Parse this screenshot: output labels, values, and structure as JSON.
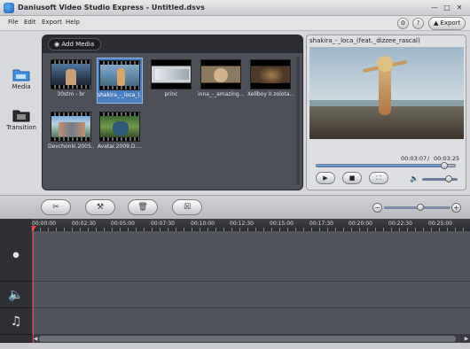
{
  "window": {
    "title": "Daniusoft Video Studio Express - Untitled.dsvs"
  },
  "menu": {
    "items": [
      "File",
      "Edit",
      "Export",
      "Help"
    ],
    "export_label": "Export"
  },
  "sidebar": {
    "items": [
      {
        "label": "Media",
        "icon": "media-folder-icon"
      },
      {
        "label": "Transition",
        "icon": "transition-icon"
      }
    ]
  },
  "media": {
    "add_label": "Add Media",
    "thumbnails": [
      {
        "caption": "30stm - br",
        "selected": false
      },
      {
        "caption": "shakira_-_loca_(...",
        "selected": true
      },
      {
        "caption": "princ",
        "selected": false
      },
      {
        "caption": "inna_-_amazing...",
        "selected": false
      },
      {
        "caption": "Xellboy II zolota...",
        "selected": false
      },
      {
        "caption": "Devchonki.2005....",
        "selected": false
      },
      {
        "caption": "Avatar.2009.D....",
        "selected": false
      }
    ]
  },
  "preview": {
    "title": "shakira_-_loca_(feat._dizzee_rascal)",
    "current_time": "00:03:07",
    "separator": "/",
    "total_time": "00:03:25",
    "progress": 0.92,
    "volume": 0.75
  },
  "toolbar": {
    "buttons": [
      "scissors-icon",
      "tools-icon",
      "trash-icon",
      "detach-icon"
    ],
    "zoom": 0.55
  },
  "timeline": {
    "ticks": [
      "00:00:00",
      "00:02:30",
      "00:05:00",
      "00:07:30",
      "00:10:00",
      "00:12:30",
      "00:15:00",
      "00:17:30",
      "00:20:00",
      "00:22:30",
      "00:25:00"
    ],
    "tracks": [
      {
        "name": "video-track",
        "icon": "film-reel-icon"
      },
      {
        "name": "audio-track",
        "icon": "speaker-icon"
      },
      {
        "name": "music-track",
        "icon": "music-note-icon"
      }
    ]
  }
}
